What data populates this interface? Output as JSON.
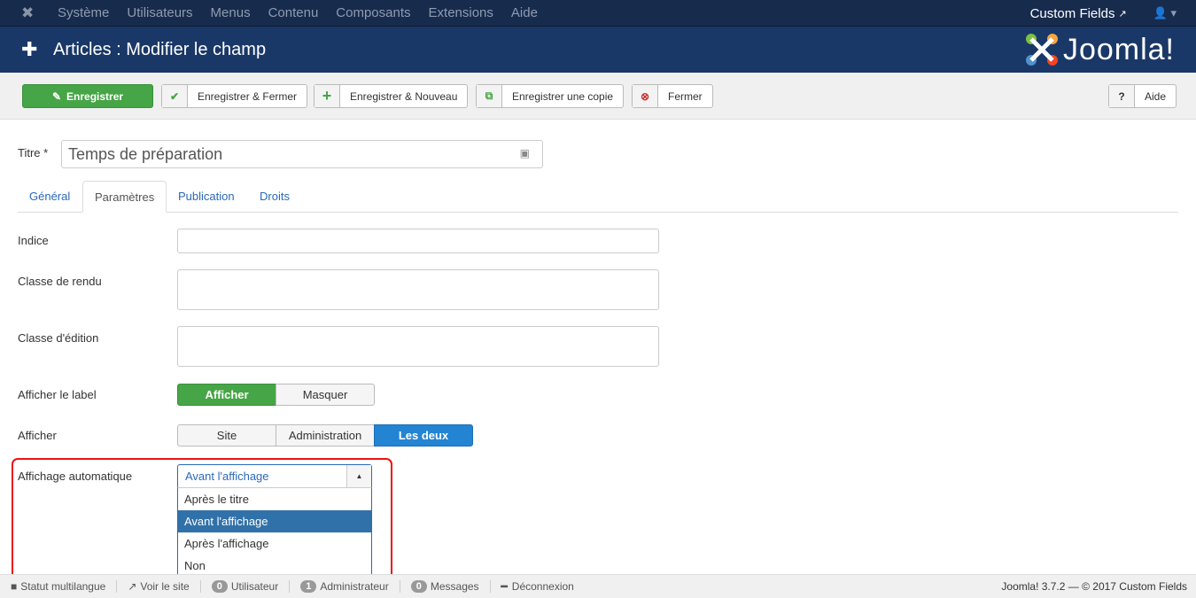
{
  "topnav": {
    "menu": [
      "Système",
      "Utilisateurs",
      "Menus",
      "Contenu",
      "Composants",
      "Extensions",
      "Aide"
    ],
    "site_link": "Custom Fields"
  },
  "header": {
    "title": "Articles : Modifier le champ",
    "logo_text": "Joomla!"
  },
  "toolbar": {
    "save": "Enregistrer",
    "save_close": "Enregistrer & Fermer",
    "save_new": "Enregistrer & Nouveau",
    "save_copy": "Enregistrer une copie",
    "close": "Fermer",
    "help": "Aide"
  },
  "form": {
    "title_label": "Titre *",
    "title_value": "Temps de préparation",
    "tabs": [
      "Général",
      "Paramètres",
      "Publication",
      "Droits"
    ],
    "active_tab": "Paramètres",
    "indice_label": "Indice",
    "render_class_label": "Classe de rendu",
    "edit_class_label": "Classe d'édition",
    "show_label": {
      "label": "Afficher le label",
      "options": [
        "Afficher",
        "Masquer"
      ],
      "selected": "Afficher"
    },
    "display": {
      "label": "Afficher",
      "options": [
        "Site",
        "Administration",
        "Les deux"
      ],
      "selected": "Les deux"
    },
    "auto_display": {
      "label": "Affichage automatique",
      "selected": "Avant l'affichage",
      "options": [
        "Après le titre",
        "Avant l'affichage",
        "Après l'affichage",
        "Non"
      ]
    }
  },
  "footer": {
    "multilang": "Statut multilangue",
    "view_site": "Voir le site",
    "users_count": "0",
    "users": "Utilisateur",
    "admins_count": "1",
    "admins": "Administrateur",
    "messages_count": "0",
    "messages": "Messages",
    "logout": "Déconnexion",
    "version": "Joomla! 3.7.2  —  © 2017 Custom Fields"
  },
  "colors": {
    "nav": "#172b4d",
    "header": "#1a3867",
    "green": "#46a546",
    "blue": "#2384d3",
    "highlight": "#3071a9",
    "annotation": "#ee1111"
  }
}
